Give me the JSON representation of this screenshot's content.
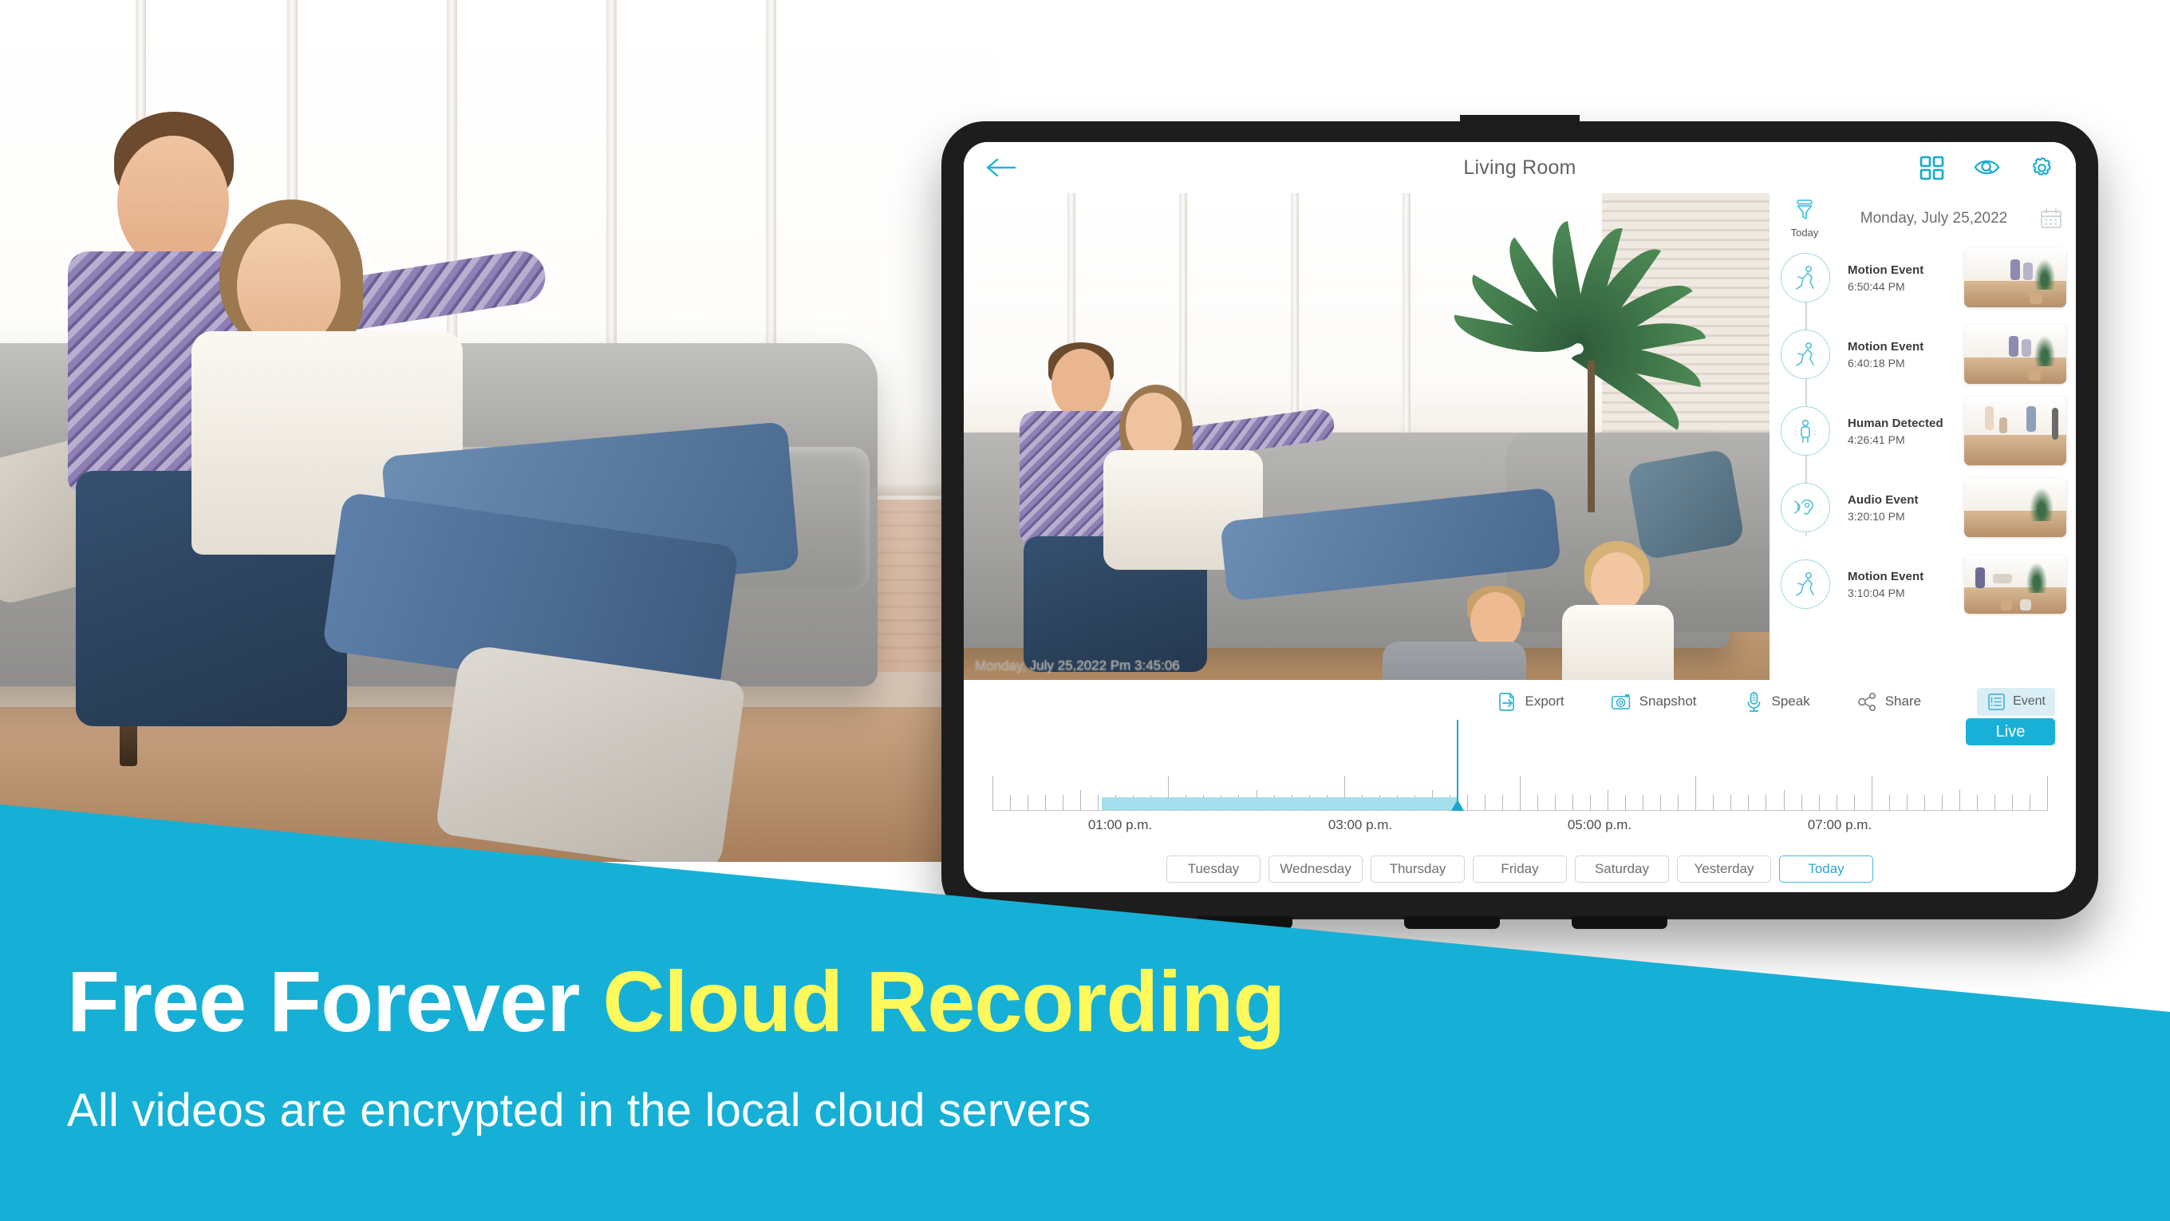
{
  "app": {
    "title": "Living Room",
    "back_icon": "back-arrow-icon",
    "header_icons": [
      "grid-view-icon",
      "eye-search-icon",
      "settings-gear-icon"
    ]
  },
  "video": {
    "timestamp": "Monday, July 25,2022 Pm 3:45:06"
  },
  "panel": {
    "filter_label": "Today",
    "filter_icon": "funnel-filter-icon",
    "date": "Monday, July 25,2022",
    "calendar_icon": "calendar-icon",
    "events": [
      {
        "name": "Motion Event",
        "time": "6:50:44 PM",
        "icon": "motion-running-icon"
      },
      {
        "name": "Motion Event",
        "time": "6:40:18 PM",
        "icon": "motion-running-icon"
      },
      {
        "name": "Human Detected",
        "time": "4:26:41 PM",
        "icon": "human-standing-icon"
      },
      {
        "name": "Audio Event",
        "time": "3:20:10 PM",
        "icon": "audio-ear-icon"
      },
      {
        "name": "Motion Event",
        "time": "3:10:04 PM",
        "icon": "motion-running-icon"
      }
    ]
  },
  "actions": [
    {
      "label": "Export",
      "icon": "export-icon"
    },
    {
      "label": "Snapshot",
      "icon": "camera-icon"
    },
    {
      "label": "Speak",
      "icon": "microphone-icon"
    },
    {
      "label": "Share",
      "icon": "share-nodes-icon"
    }
  ],
  "mode": {
    "event_label": "Event",
    "event_icon": "event-list-icon",
    "live_label": "Live"
  },
  "timeline": {
    "hour_labels": [
      "01:00 p.m.",
      "03:00 p.m.",
      "05:00 p.m.",
      "07:00 p.m."
    ],
    "playhead_time": "3:45 p.m.",
    "recorded_from": "12:30 p.m.",
    "recorded_to": "3:45 p.m.",
    "accent_color": "#19a7cc",
    "band_color": "#a5dfee"
  },
  "days": [
    {
      "label": "Tuesday",
      "active": false
    },
    {
      "label": "Wednesday",
      "active": false
    },
    {
      "label": "Thursday",
      "active": false
    },
    {
      "label": "Friday",
      "active": false
    },
    {
      "label": "Saturday",
      "active": false
    },
    {
      "label": "Yesterday",
      "active": false
    },
    {
      "label": "Today",
      "active": true
    }
  ],
  "banner": {
    "headline_white": "Free Forever ",
    "headline_accent": "Cloud Recording",
    "subline": "All videos are encrypted in the local cloud servers",
    "bg_color": "#16b0d6",
    "accent_color": "#fff95b"
  }
}
